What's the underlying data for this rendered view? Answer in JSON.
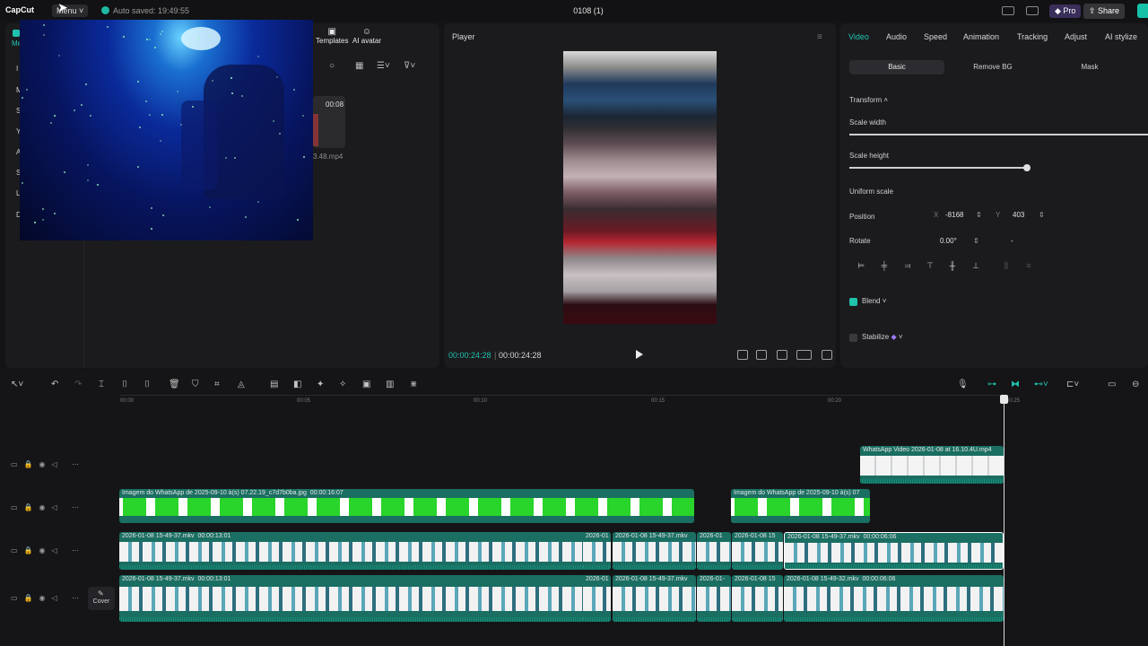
{
  "topbar": {
    "logo": "CapCut",
    "menu": "Menu",
    "autosave": "Auto saved: 19:49:55",
    "project_title": "0108 (1)",
    "pro": "Pro",
    "share": "Share"
  },
  "media": {
    "side_tabs": [
      "Me",
      "I",
      "M",
      "S",
      "Y",
      "A",
      "S",
      "L",
      "D"
    ],
    "tools": [
      "Templates",
      "AI avatar"
    ],
    "clip_duration": "00:08",
    "clip_name": "3.48.mp4"
  },
  "player": {
    "title": "Player",
    "current_time": "00:00:24:28",
    "total_time": "00:00:24:28"
  },
  "inspector": {
    "tabs": [
      "Video",
      "Audio",
      "Speed",
      "Animation",
      "Tracking",
      "Adjust",
      "AI stylize"
    ],
    "subtabs": [
      "Basic",
      "Remove BG",
      "Mask"
    ],
    "transform_label": "Transform",
    "scale_width": "Scale width",
    "scale_height": "Scale height",
    "uniform_scale": "Uniform scale",
    "position_label": "Position",
    "pos_x_label": "X",
    "pos_x": "-8168",
    "pos_y_label": "Y",
    "pos_y": "403",
    "rotate_label": "Rotate",
    "rotate_value": "0.00°",
    "rotate_extra": "-",
    "blend": "Blend",
    "stabilize": "Stabilize"
  },
  "timeline": {
    "ruler": [
      "00:00",
      "00:05",
      "00:10",
      "00:15",
      "00:20",
      "00:25"
    ],
    "tracks": [
      {
        "clips": [
          {
            "label": "WhatsApp Video 2026-01-08 at 16.10.4U.mp4",
            "duration": ""
          }
        ]
      },
      {
        "clips": [
          {
            "label": "Imagem do WhatsApp de 2025-09-10 à(s) 07.22.19_c7d7b0ba.jpg",
            "duration": "00:00:16:07"
          },
          {
            "label": "Imagem do WhatsApp de 2025-09-10 à(s) 07",
            "duration": ""
          }
        ]
      },
      {
        "clips": [
          {
            "label": "2026-01-08 15-49-37.mkv",
            "duration": "00:00:13:01"
          },
          {
            "label": "2026-01",
            "duration": ""
          },
          {
            "label": "2026-01-08 15-49-37.mkv",
            "duration": ""
          },
          {
            "label": "2026-01",
            "duration": ""
          },
          {
            "label": "2026-01-08 15",
            "duration": ""
          },
          {
            "label": "2026-01-08 15-49-37.mkv",
            "duration": "00:00:06:06"
          }
        ]
      },
      {
        "clips": [
          {
            "label": "2026-01-08 15-49-37.mkv",
            "duration": "00:00:13:01"
          },
          {
            "label": "2026-01",
            "duration": ""
          },
          {
            "label": "2026-01-08 15-49-37.mkv",
            "duration": ""
          },
          {
            "label": "2026-01-",
            "duration": ""
          },
          {
            "label": "2026-01-08 15",
            "duration": ""
          },
          {
            "label": "2026-01-08 15-49-32.mkv",
            "duration": "00:00:06:06"
          }
        ]
      }
    ],
    "cover": "Cover"
  },
  "colors": {
    "accent": "#1fc2ac",
    "clip_teal": "#1b6e62",
    "green_screen": "#29d42b"
  }
}
